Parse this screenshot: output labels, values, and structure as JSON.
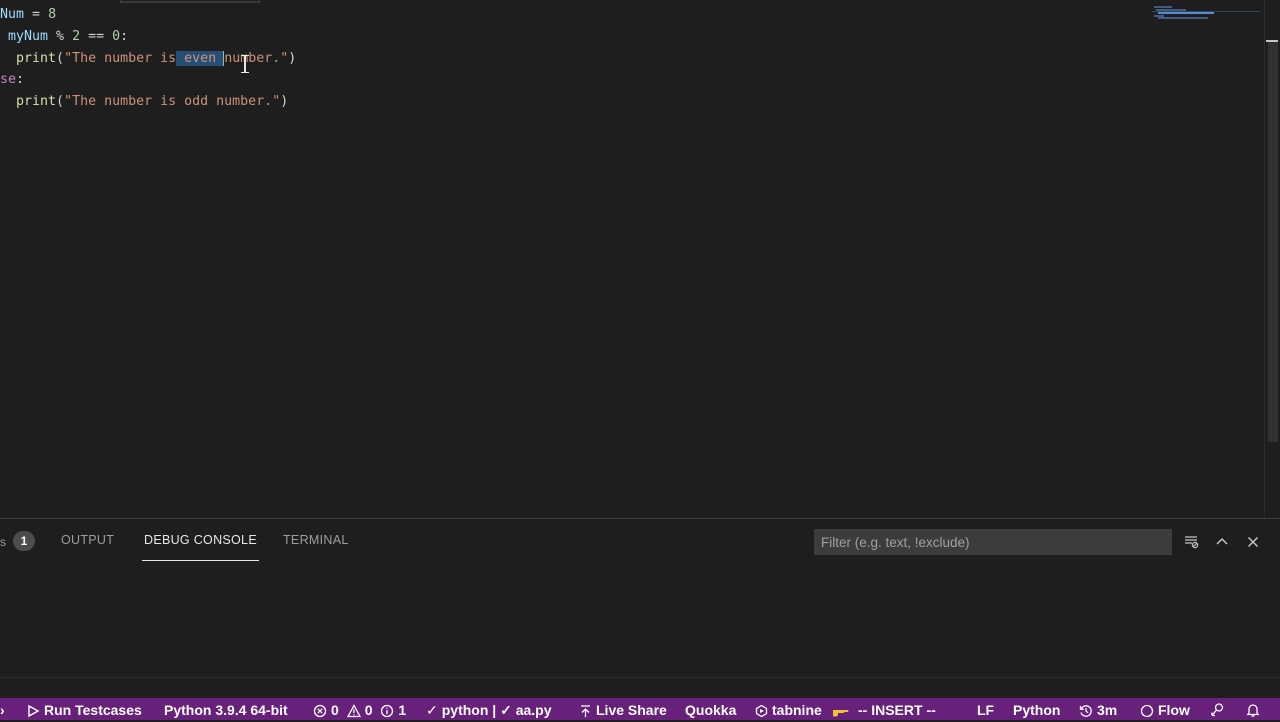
{
  "editor": {
    "lines": [
      {
        "tokens": [
          {
            "t": "Num",
            "c": "var"
          },
          {
            "t": " = ",
            "c": "op"
          },
          {
            "t": "8",
            "c": "num"
          }
        ]
      },
      {
        "tokens": [
          {
            "t": " myNum",
            "c": "var"
          },
          {
            "t": " % ",
            "c": "op"
          },
          {
            "t": "2",
            "c": "num"
          },
          {
            "t": " == ",
            "c": "op"
          },
          {
            "t": "0",
            "c": "num"
          },
          {
            "t": ":",
            "c": "op"
          }
        ]
      },
      {
        "tokens": [
          {
            "t": "  print",
            "c": "fn"
          },
          {
            "t": "(",
            "c": "op"
          },
          {
            "t": "\"The number is",
            "c": "str"
          },
          {
            "t": " even ",
            "c": "str",
            "sel": true
          },
          {
            "t": "number.\"",
            "c": "str"
          },
          {
            "t": ")",
            "c": "op"
          }
        ]
      },
      {
        "tokens": [
          {
            "t": "se",
            "c": "kw"
          },
          {
            "t": ":",
            "c": "op"
          }
        ]
      },
      {
        "tokens": [
          {
            "t": "  print",
            "c": "fn"
          },
          {
            "t": "(",
            "c": "op"
          },
          {
            "t": "\"The number is odd number.\"",
            "c": "str"
          },
          {
            "t": ")",
            "c": "op"
          }
        ]
      }
    ]
  },
  "panel": {
    "problems_count": "1",
    "tabs": [
      {
        "label": "OUTPUT",
        "active": false
      },
      {
        "label": "DEBUG CONSOLE",
        "active": true
      },
      {
        "label": "TERMINAL",
        "active": false
      }
    ],
    "filter_placeholder": "Filter (e.g. text, !exclude)"
  },
  "statusbar": {
    "background": "#68217a",
    "run_testcases": "Run Testcases",
    "python_interpreter": "Python 3.9.4 64-bit",
    "errors": "0",
    "warnings": "0",
    "infos": "1",
    "python_check": "python | ✓ aa.py",
    "live_share": "Live Share",
    "quokka": "Quokka",
    "tabnine": "tabnine",
    "vim_mode": "-- INSERT --",
    "eol": "LF",
    "language": "Python",
    "time": "3m",
    "flow": "Flow"
  }
}
